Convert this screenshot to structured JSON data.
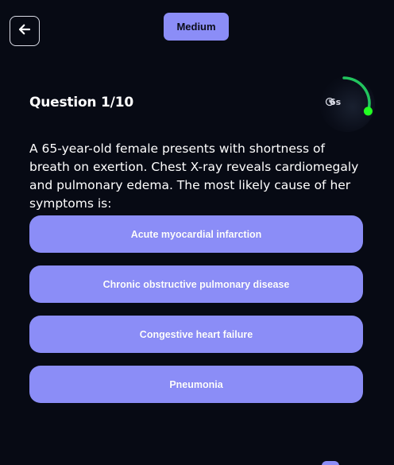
{
  "header": {
    "back_label": "Back",
    "difficulty": "Medium"
  },
  "question": {
    "title": "Question 1/10",
    "text": "A 65-year-old female presents with shortness of breath on exertion. Chest X-ray reveals cardiomegaly and pulmonary edema. The most likely cause of her symptoms is:"
  },
  "timer": {
    "label": "6s",
    "remaining_seconds": 6,
    "progress_fraction": 0.3,
    "icon": "clock-icon",
    "ring_color": "#22c55e"
  },
  "options": [
    {
      "label": "Acute myocardial infarction"
    },
    {
      "label": "Chronic obstructive pulmonary disease"
    },
    {
      "label": "Congestive heart failure"
    },
    {
      "label": "Pneumonia"
    }
  ],
  "colors": {
    "background": "#070a14",
    "accent": "#8b8df7",
    "timer_green": "#22c55e"
  }
}
